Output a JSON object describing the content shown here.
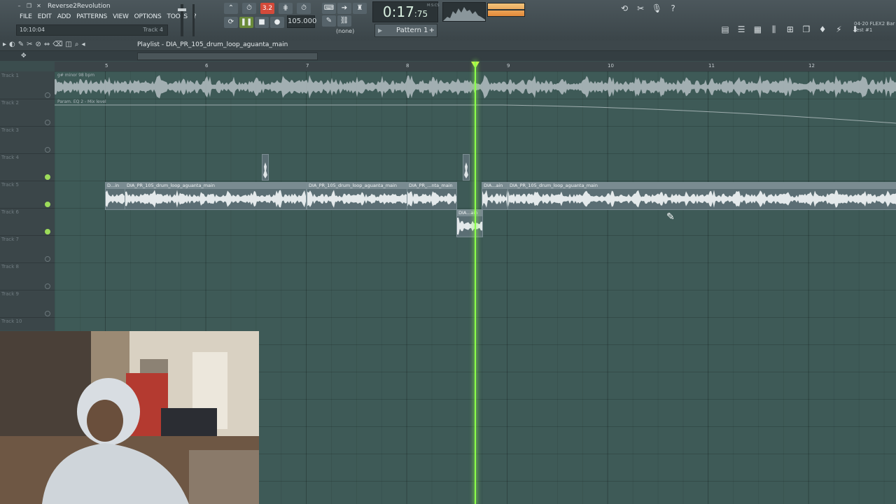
{
  "window": {
    "title": "Reverse2Revolution",
    "hint_time": "10:10:04",
    "hint_track": "Track 4"
  },
  "menu": [
    "FILE",
    "EDIT",
    "ADD",
    "PATTERNS",
    "VIEW",
    "OPTIONS",
    "TOOLS",
    "?"
  ],
  "transport": {
    "mode_badge": "3.2",
    "tempo": "105.000",
    "time_main": "0:17",
    "time_sub": "75",
    "time_unit": "M:S:CS",
    "none_label": "(none)"
  },
  "pattern": {
    "selected": "Pattern 1"
  },
  "flex": {
    "line1": "04-20  FLEX2 Bar",
    "line2": "Test #1"
  },
  "playlist": {
    "title": "Playlist - DIA_PR_105_drum_loop_aguanta_main",
    "ruler_bars": [
      "5",
      "6",
      "7",
      "8",
      "9",
      "10",
      "11",
      "12"
    ],
    "track_names": [
      "Track 1",
      "Track 2",
      "Track 3",
      "Track 4",
      "Track 5",
      "Track 6",
      "Track 7",
      "Track 8",
      "Track 9",
      "Track 10"
    ],
    "lane1_label": "g# minor 98 bpm",
    "lane2_label": "Param. EQ 2 - Mix level",
    "clips": [
      {
        "name": "D...in",
        "label": "DIA_PR_105_drum_loop_aguanta_main"
      },
      {
        "name": "clip-b",
        "label": "DIA_PR_105_drum_loop_aguanta_main"
      },
      {
        "name": "clip-c",
        "label": "DIA_PR_...nta_main"
      },
      {
        "name": "clip-d",
        "label": "DIA...ain"
      },
      {
        "name": "clip-e",
        "label": "DIA_PR_105_drum_loop_aguanta_main"
      },
      {
        "name": "clip-f",
        "label": "DIA...ain"
      }
    ]
  },
  "colors": {
    "accent_playhead": "#8cff4a",
    "grid": "#3e5a57",
    "clip": "#5b6e74"
  }
}
